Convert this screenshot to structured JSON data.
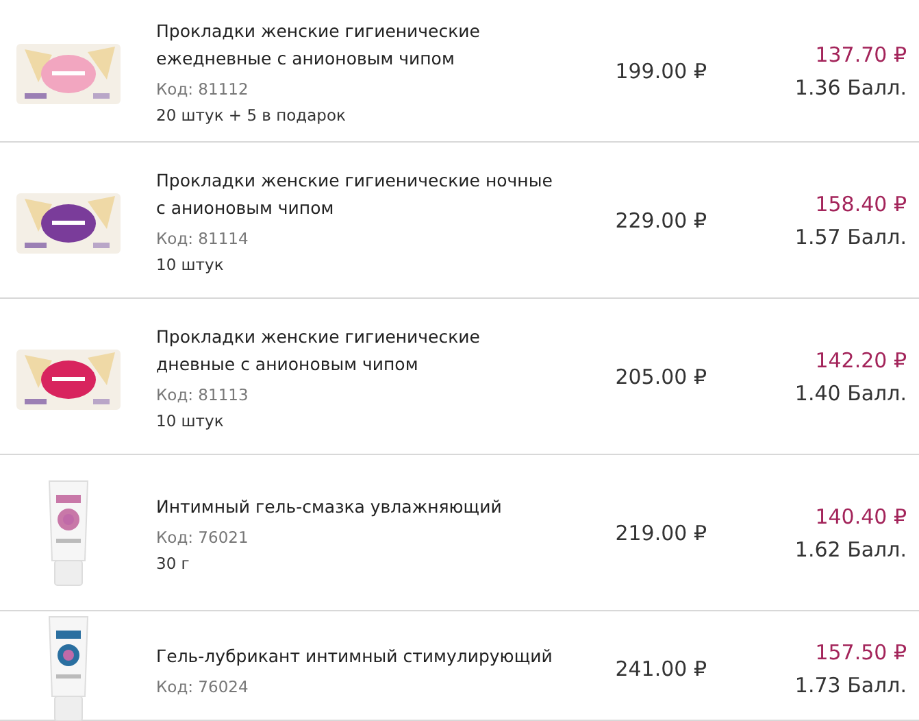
{
  "products": [
    {
      "name": "Прокладки женские гигиенические ежедневные с анионовым чипом",
      "code": "Код: 81112",
      "note": "20 штук + 5 в подарок",
      "price": "199.00 ₽",
      "sale_price": "137.70 ₽",
      "points": "1.36 Балл.",
      "kind": "pad-pack"
    },
    {
      "name": "Прокладки женские гигиенические ночные с анионовым чипом",
      "code": "Код: 81114",
      "note": "10 штук",
      "price": "229.00 ₽",
      "sale_price": "158.40 ₽",
      "points": "1.57 Балл.",
      "kind": "pad-pack"
    },
    {
      "name": "Прокладки женские гигиенические дневные с анионовым чипом",
      "code": "Код: 81113",
      "note": "10 штук",
      "price": "205.00 ₽",
      "sale_price": "142.20 ₽",
      "points": "1.40 Балл.",
      "kind": "pad-pack"
    },
    {
      "name": "Интимный гель-смазка увлажняющий",
      "code": "Код: 76021",
      "note": "30 г",
      "price": "219.00 ₽",
      "sale_price": "140.40 ₽",
      "points": "1.62 Балл.",
      "kind": "tube"
    },
    {
      "name": "Гель-лубрикант интимный стимулирующий",
      "code": "Код: 76024",
      "price": "241.00 ₽",
      "sale_price": "157.50 ₽",
      "points": "1.73 Балл.",
      "kind": "tube"
    }
  ]
}
